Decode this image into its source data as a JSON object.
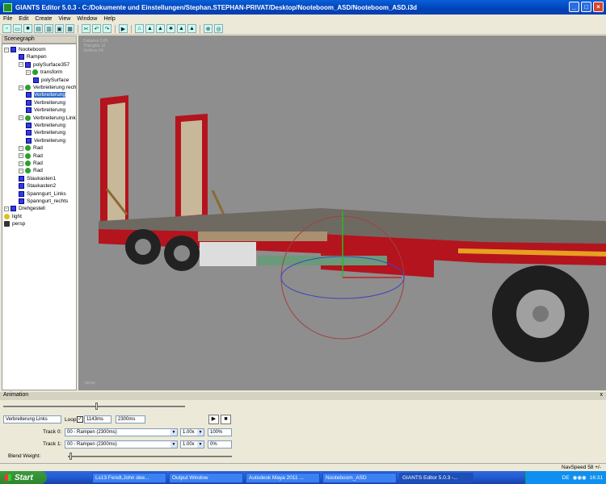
{
  "window": {
    "title": "GIANTS Editor 5.0.3 - C:/Dokumente und Einstellungen/Stephan.STEPHAN-PRIVAT/Desktop/Nooteboom_ASD/Nooteboom_ASD.i3d"
  },
  "menu": [
    "File",
    "Edit",
    "Create",
    "View",
    "Window",
    "Help"
  ],
  "scenegraph": {
    "title": "Scenegraph",
    "nodes": [
      {
        "label": "Nooteboom",
        "icon": "cube"
      },
      {
        "label": "Rampen",
        "icon": "cube"
      },
      {
        "label": "polySurface357",
        "icon": "cube"
      },
      {
        "label": "transform",
        "icon": "transform"
      },
      {
        "label": "polySurface",
        "icon": "cube"
      },
      {
        "label": "Verbreiterung recht",
        "icon": "transform"
      },
      {
        "label": "Verbreiterung",
        "icon": "cube",
        "selected": true
      },
      {
        "label": "Verbreiterung",
        "icon": "cube"
      },
      {
        "label": "Verbreiterung",
        "icon": "cube"
      },
      {
        "label": "Verbreiterung Links",
        "icon": "transform"
      },
      {
        "label": "Verbreiterung",
        "icon": "cube"
      },
      {
        "label": "Verbreiterung",
        "icon": "cube"
      },
      {
        "label": "Verbreiterung",
        "icon": "cube"
      },
      {
        "label": "Rad",
        "icon": "transform"
      },
      {
        "label": "Rad",
        "icon": "transform"
      },
      {
        "label": "Rad",
        "icon": "transform"
      },
      {
        "label": "Rad",
        "icon": "transform"
      },
      {
        "label": "Staukasten1",
        "icon": "cube"
      },
      {
        "label": "Staukasten2",
        "icon": "cube"
      },
      {
        "label": "Spanngurt_Links",
        "icon": "cube"
      },
      {
        "label": "Spanngurt_rechts",
        "icon": "cube"
      },
      {
        "label": "Drehgestell",
        "icon": "cube"
      },
      {
        "label": "light",
        "icon": "light"
      },
      {
        "label": "persp",
        "icon": "camera"
      }
    ]
  },
  "viewport": {
    "stats": [
      "Distance 3.65",
      "Triangles 12",
      "Vertices 24"
    ],
    "camera": "persp",
    "colors": {
      "background": "#8e8e8e",
      "trailer": "#b4141e",
      "deck": "#6e6a62",
      "ramp": "#c8b89a"
    }
  },
  "animation": {
    "title": "Animation",
    "close": "x",
    "clip_name": "Verbreiterung Links",
    "loop_label": "Loop",
    "loop_checked": true,
    "time_current": "1143ms",
    "time_total": "2300ms",
    "tracks": [
      {
        "label": "Track 0:",
        "clip": "00 - Rampen (2300ms)",
        "speed": "1.00x",
        "weight": "100%"
      },
      {
        "label": "Track 1:",
        "clip": "00 - Rampen (2300ms)",
        "speed": "1.00x",
        "weight": "0%"
      }
    ],
    "blend_label": "Blend Weight:"
  },
  "status": {
    "navspeed": "NavSpeed 58 +/-"
  },
  "taskbar": {
    "start": "Start",
    "tasks": [
      "Ls13 Fendt,John dee...",
      "Output Window",
      "Autodesk Maya 2011 ...",
      "Nooteboom_ASD",
      "GIANTS Editor 5.0.3 -..."
    ],
    "lang": "DE",
    "clock": "16:31"
  }
}
